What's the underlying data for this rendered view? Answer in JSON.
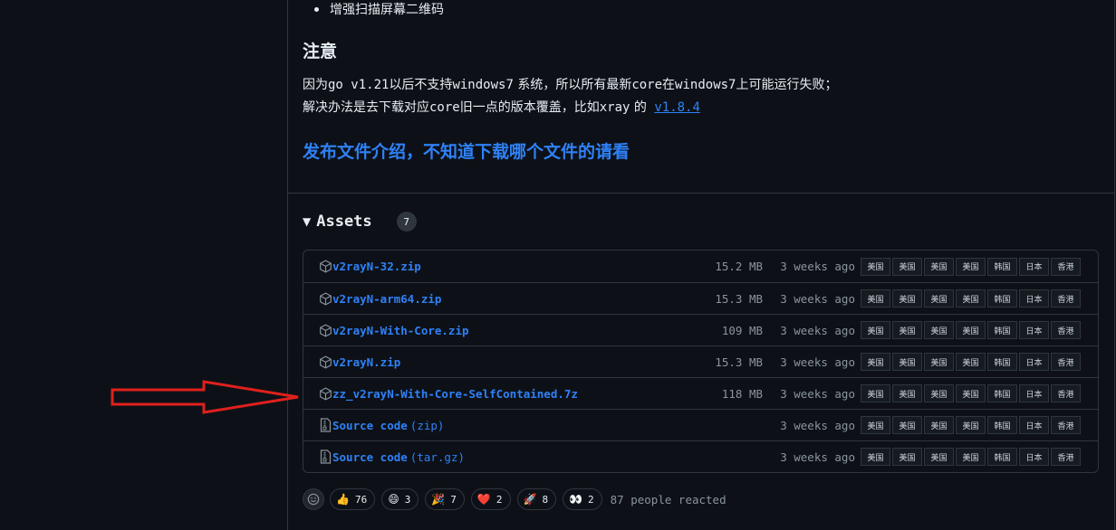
{
  "notes": {
    "bullet": "增强扫描屏幕二维码",
    "note_title": "注意",
    "line1_a": "因为",
    "line1_b": "go v1.21",
    "line1_c": "以后不支持",
    "line1_d": "windows7",
    "line1_e": " 系统，所以所有最新",
    "line1_f": "core",
    "line1_g": "在",
    "line1_h": "windows7",
    "line1_i": "上可能运行失败；",
    "line2_a": "解决办法是去下载对应",
    "line2_b": "core",
    "line2_c": "旧一点的版本覆盖，比如",
    "line2_d": "xray",
    "line2_e": " 的 ",
    "version_link": "v1.8.4",
    "release_link": "发布文件介绍，不知道下载哪个文件的请看"
  },
  "assets": {
    "label": "Assets",
    "count": "7",
    "rows": [
      {
        "name": "v2rayN-32.zip",
        "suffix": "",
        "size": "15.2 MB",
        "time": "3 weeks ago",
        "kind": "package-icon"
      },
      {
        "name": "v2rayN-arm64.zip",
        "suffix": "",
        "size": "15.3 MB",
        "time": "3 weeks ago",
        "kind": "package-icon"
      },
      {
        "name": "v2rayN-With-Core.zip",
        "suffix": "",
        "size": "109 MB",
        "time": "3 weeks ago",
        "kind": "package-icon"
      },
      {
        "name": "v2rayN.zip",
        "suffix": "",
        "size": "15.3 MB",
        "time": "3 weeks ago",
        "kind": "package-icon"
      },
      {
        "name": "zz_v2rayN-With-Core-SelfContained.7z",
        "suffix": "",
        "size": "118 MB",
        "time": "3 weeks ago",
        "kind": "package-icon"
      },
      {
        "name": "Source code",
        "suffix": "(zip)",
        "size": "",
        "time": "3 weeks ago",
        "kind": "file-zip-icon"
      },
      {
        "name": "Source code",
        "suffix": "(tar.gz)",
        "size": "",
        "time": "3 weeks ago",
        "kind": "file-zip-icon"
      }
    ],
    "mirrors": [
      "美国",
      "美国",
      "美国",
      "美国",
      "韩国",
      "日本",
      "香港"
    ]
  },
  "reactions": {
    "items": [
      {
        "emoji": "👍",
        "count": "76"
      },
      {
        "emoji": "😄",
        "count": "3"
      },
      {
        "emoji": "🎉",
        "count": "7"
      },
      {
        "emoji": "❤️",
        "count": "2"
      },
      {
        "emoji": "🚀",
        "count": "8"
      },
      {
        "emoji": "👀",
        "count": "2"
      }
    ],
    "summary": "87 people reacted"
  },
  "colors": {
    "background": "#0d1117",
    "link": "#2f81f7",
    "muted": "#8b949e",
    "border": "#30363d",
    "annotation_arrow": "#e0201c"
  }
}
